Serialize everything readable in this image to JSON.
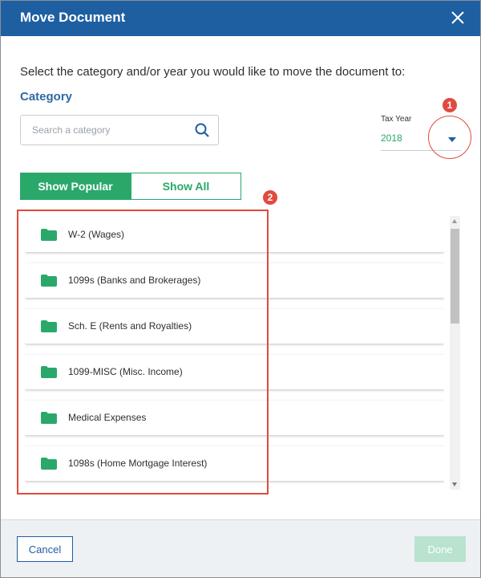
{
  "dialog": {
    "title": "Move Document"
  },
  "instruction": "Select the category and/or year you would like to move the document to:",
  "category": {
    "label": "Category",
    "search_placeholder": "Search a category"
  },
  "tax_year": {
    "label": "Tax Year",
    "value": "2018"
  },
  "toggle": {
    "popular": "Show Popular",
    "all": "Show All",
    "active": "popular"
  },
  "categories": [
    {
      "label": "W-2 (Wages)"
    },
    {
      "label": "1099s (Banks and Brokerages)"
    },
    {
      "label": "Sch. E (Rents and Royalties)"
    },
    {
      "label": "1099-MISC (Misc. Income)"
    },
    {
      "label": "Medical Expenses"
    },
    {
      "label": "1098s (Home Mortgage Interest)"
    }
  ],
  "annotations": {
    "badge1": "1",
    "badge2": "2"
  },
  "footer": {
    "cancel": "Cancel",
    "done": "Done"
  },
  "colors": {
    "header": "#1e5fa2",
    "accent_green": "#2aa86a",
    "annotation_red": "#e04b3f",
    "done_disabled": "#b9e3cf"
  },
  "icons": {
    "close": "close-icon",
    "search": "search-icon",
    "folder": "folder-icon",
    "dropdown": "chevron-down-icon"
  }
}
